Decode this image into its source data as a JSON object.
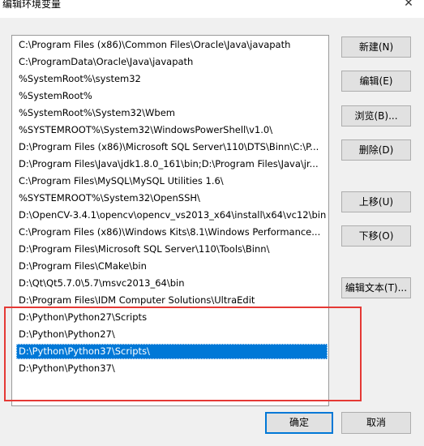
{
  "window": {
    "title": "编辑环境变量",
    "close_glyph": "✕"
  },
  "list": {
    "items": [
      {
        "label": "C:\\Program Files (x86)\\Common Files\\Oracle\\Java\\javapath",
        "selected": false
      },
      {
        "label": "C:\\ProgramData\\Oracle\\Java\\javapath",
        "selected": false
      },
      {
        "label": "%SystemRoot%\\system32",
        "selected": false
      },
      {
        "label": "%SystemRoot%",
        "selected": false
      },
      {
        "label": "%SystemRoot%\\System32\\Wbem",
        "selected": false
      },
      {
        "label": "%SYSTEMROOT%\\System32\\WindowsPowerShell\\v1.0\\",
        "selected": false
      },
      {
        "label": "D:\\Program Files (x86)\\Microsoft SQL Server\\110\\DTS\\Binn\\C:\\P...",
        "selected": false
      },
      {
        "label": "D:\\Program Files\\Java\\jdk1.8.0_161\\bin;D:\\Program Files\\Java\\jr...",
        "selected": false
      },
      {
        "label": "C:\\Program Files\\MySQL\\MySQL Utilities 1.6\\",
        "selected": false
      },
      {
        "label": "%SYSTEMROOT%\\System32\\OpenSSH\\",
        "selected": false
      },
      {
        "label": "D:\\OpenCV-3.4.1\\opencv\\opencv_vs2013_x64\\install\\x64\\vc12\\bin",
        "selected": false
      },
      {
        "label": "C:\\Program Files (x86)\\Windows Kits\\8.1\\Windows Performance...",
        "selected": false
      },
      {
        "label": "D:\\Program Files\\Microsoft SQL Server\\110\\Tools\\Binn\\",
        "selected": false
      },
      {
        "label": "D:\\Program Files\\CMake\\bin",
        "selected": false
      },
      {
        "label": "D:\\Qt\\Qt5.7.0\\5.7\\msvc2013_64\\bin",
        "selected": false
      },
      {
        "label": "D:\\Program Files\\IDM Computer Solutions\\UltraEdit",
        "selected": false
      },
      {
        "label": "D:\\Python\\Python27\\Scripts",
        "selected": false
      },
      {
        "label": "D:\\Python\\Python27\\",
        "selected": false
      },
      {
        "label": "D:\\Python\\Python37\\Scripts\\",
        "selected": true
      },
      {
        "label": "D:\\Python\\Python37\\",
        "selected": false
      }
    ]
  },
  "buttons": {
    "new": "新建(N)",
    "edit": "编辑(E)",
    "browse": "浏览(B)...",
    "delete": "删除(D)",
    "move_up": "上移(U)",
    "move_down": "下移(O)",
    "edit_text": "编辑文本(T)...",
    "ok": "确定",
    "cancel": "取消"
  },
  "colors": {
    "selection": "#0078d7",
    "highlight_box": "#e53935"
  }
}
